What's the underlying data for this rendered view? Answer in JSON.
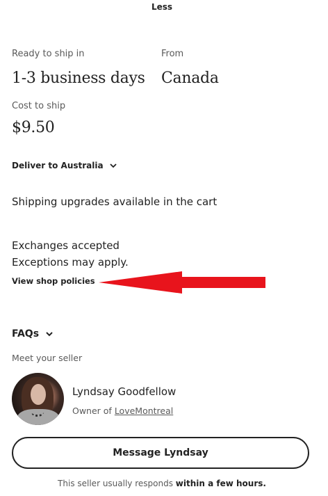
{
  "header": {
    "less_label": "Less"
  },
  "shipping": {
    "ready_label": "Ready to ship in",
    "ready_value": "1-3 business days",
    "from_label": "From",
    "from_value": "Canada",
    "cost_label": "Cost to ship",
    "cost_value": "$9.50",
    "deliver_label": "Deliver to Australia",
    "upgrades_text": "Shipping upgrades available in the cart"
  },
  "policies": {
    "exchanges_text": "Exchanges accepted",
    "exceptions_text": "Exceptions may apply.",
    "view_link": "View shop policies"
  },
  "annotation": {
    "arrow_color": "#e8141c"
  },
  "faqs": {
    "label": "FAQs"
  },
  "seller": {
    "meet_label": "Meet your seller",
    "name": "Lyndsay Goodfellow",
    "owner_prefix": "Owner of ",
    "shop_name": "LoveMontreal",
    "message_button": "Message Lyndsay",
    "responds_prefix": "This seller usually responds ",
    "responds_bold": "within a few hours."
  },
  "icons": [
    "chevron-down-icon",
    "avatar"
  ]
}
